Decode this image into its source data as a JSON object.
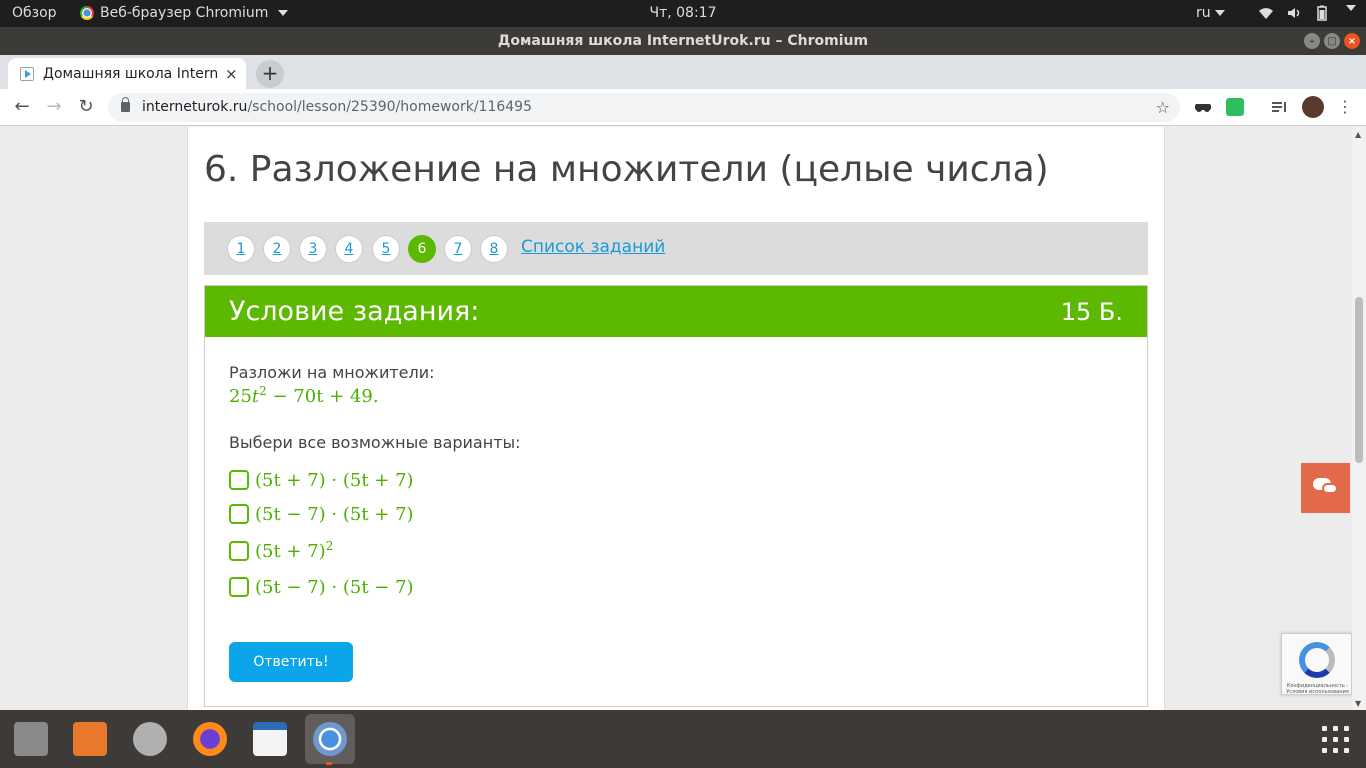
{
  "system_bar": {
    "overview": "Обзор",
    "app_menu": "Веб-браузер Chromium",
    "clock": "Чт, 08:17",
    "language": "ru"
  },
  "window": {
    "title": "Домашняя школа InternetUrok.ru – Chromium"
  },
  "browser": {
    "tab_title": "Домашняя школа Interne",
    "tab_close": "×",
    "new_tab": "+",
    "url_domain": "interneturok.ru",
    "url_path": "/school/lesson/25390/homework/116495"
  },
  "lesson": {
    "title": "6. Разложение на множители (целые числа)",
    "pages": [
      "1",
      "2",
      "3",
      "4",
      "5",
      "6",
      "7",
      "8"
    ],
    "active_page": "6",
    "task_list_link": "Список заданий"
  },
  "task": {
    "header": "Условие задания:",
    "points": "15 Б.",
    "prompt": "Разложи на множители:",
    "expression": {
      "a": "25",
      "var": "t",
      "exp": "2",
      "rest": " − 70t + 49."
    },
    "choose_label": "Выбери все возможные варианты:",
    "options": [
      {
        "text": "(5t + 7) · (5t + 7)",
        "sup": ""
      },
      {
        "text": "(5t − 7) · (5t + 7)",
        "sup": ""
      },
      {
        "text": "(5t + 7)",
        "sup": "2"
      },
      {
        "text": "(5t − 7) · (5t − 7)",
        "sup": ""
      }
    ],
    "answer_button": "Ответить!"
  },
  "recaptcha": {
    "text": "Конфиденциальность - Условия использования"
  },
  "colors": {
    "accent_green": "#5cb800",
    "button_blue": "#0ba6e9",
    "link_blue": "#1a9ad6",
    "chat_orange": "#e26a4a"
  }
}
